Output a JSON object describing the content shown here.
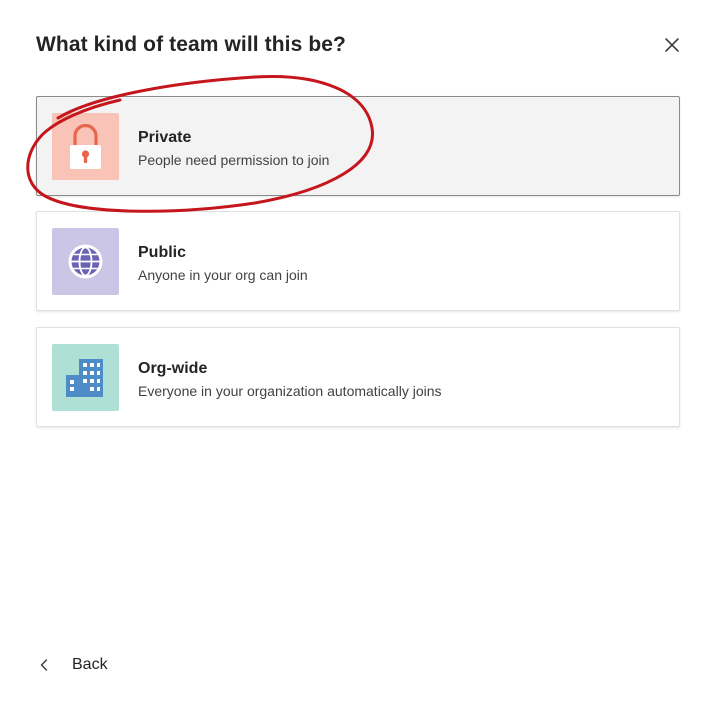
{
  "dialog": {
    "title": "What kind of team will this be?",
    "close_icon": "close-icon"
  },
  "options": [
    {
      "title": "Private",
      "description": "People need permission to join",
      "icon": "lock-icon",
      "tile_color": "#f9c3b7",
      "icon_color": "#e8664d",
      "selected": true
    },
    {
      "title": "Public",
      "description": "Anyone in your org can join",
      "icon": "globe-icon",
      "tile_color": "#cbc5e6",
      "icon_color": "#6b62b3",
      "selected": false
    },
    {
      "title": "Org-wide",
      "description": "Everyone in your organization automatically joins",
      "icon": "building-icon",
      "tile_color": "#aee0d5",
      "icon_color": "#4d8cc7",
      "selected": false
    }
  ],
  "footer": {
    "back_label": "Back",
    "back_icon": "chevron-left-icon"
  },
  "annotation": {
    "shape": "hand-drawn-circle",
    "color": "#c5161d"
  }
}
